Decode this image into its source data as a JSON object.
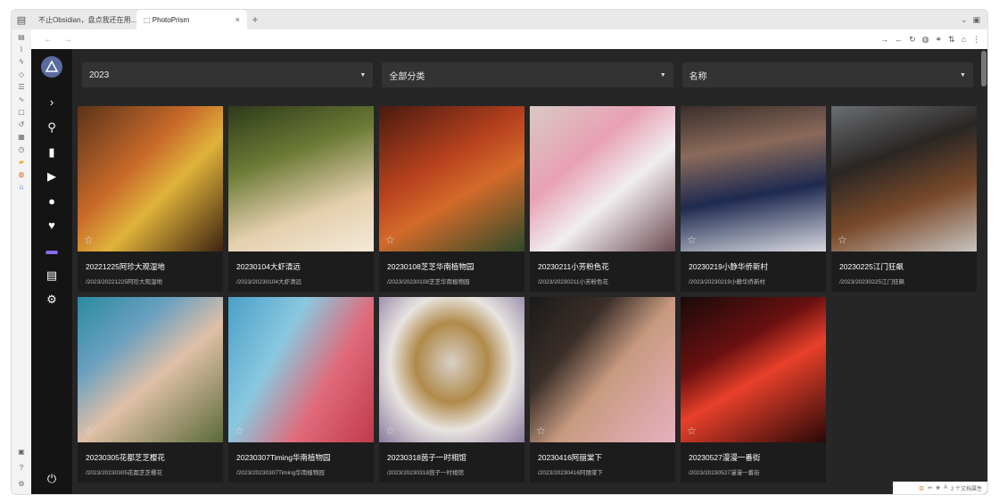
{
  "browser": {
    "tabs": [
      {
        "label": "不止Obsidian，盘点我还在用..."
      },
      {
        "label": "PhotoPrism"
      }
    ],
    "new_tab": "+",
    "close": "×"
  },
  "filters": [
    {
      "value": "2023"
    },
    {
      "value": "全部分类"
    },
    {
      "value": "名称"
    }
  ],
  "colors": {
    "rail": "#141414",
    "main_bg": "#262626",
    "card_bg": "#1c1c1c"
  },
  "cards": [
    {
      "title": "20221225阿珍大观湿地",
      "path": "/2023/20221225阿珍大观湿地"
    },
    {
      "title": "20230104大虾清远",
      "path": "/2023/20230104大虾清远"
    },
    {
      "title": "20230108芝芝华南植物园",
      "path": "/2023/20230108芝芝华南植物园"
    },
    {
      "title": "20230211小芳粉色花",
      "path": "/2023/20230211小芳粉色花"
    },
    {
      "title": "20230219小静华侨新村",
      "path": "/2023/20230219小静华侨新村"
    },
    {
      "title": "20230225江门狂飙",
      "path": "/2023/20230225江门狂飙"
    },
    {
      "title": "20230305花都芝芝樱花",
      "path": "/2023/20230305花都芝芝樱花"
    },
    {
      "title": "20230307Timing华南植物园",
      "path": "/2023/20230307Timing华南植物园"
    },
    {
      "title": "20230318茵子一时相馆",
      "path": "/2023/20230318茵子一时相馆"
    },
    {
      "title": "20230416阿丽棠下",
      "path": "/2023/20230416阿丽棠下"
    },
    {
      "title": "20230527漫漫一番街",
      "path": "/2023/20230527漫漫一番街"
    }
  ],
  "status": {
    "label": "2 个文档属性"
  }
}
